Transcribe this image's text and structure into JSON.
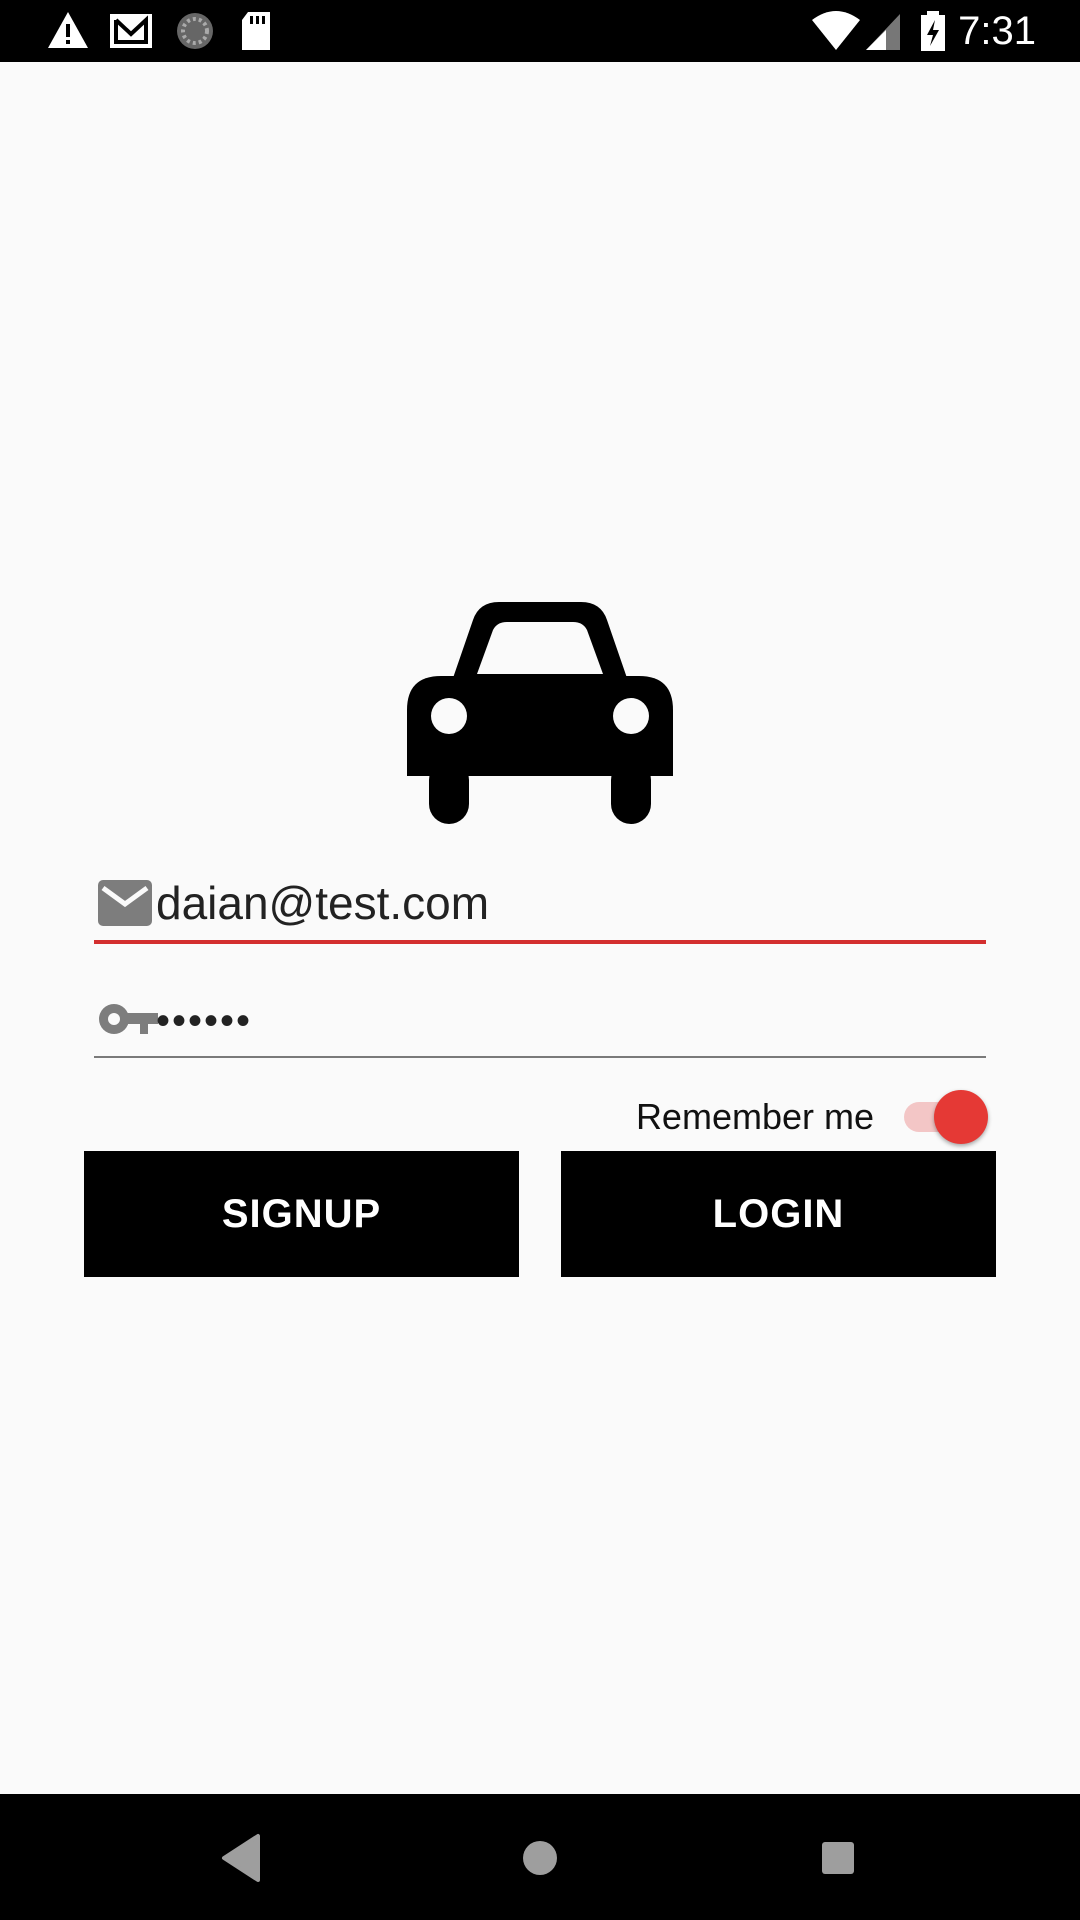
{
  "status_bar": {
    "time": "7:31",
    "left_icons": [
      "warning-icon",
      "gmail-icon",
      "sync-icon",
      "sd-card-icon"
    ],
    "right_icons": [
      "wifi-icon",
      "signal-icon",
      "battery-charging-icon"
    ]
  },
  "logo": {
    "icon": "car-icon"
  },
  "form": {
    "email": {
      "icon": "email-icon",
      "value": "daian@test.com",
      "underline_color": "#d32f2f"
    },
    "password": {
      "icon": "key-icon",
      "value": "••••••",
      "underline_color": "#7a7a7a"
    },
    "remember_me": {
      "label": "Remember me",
      "checked": true,
      "accent": "#e53935"
    }
  },
  "buttons": {
    "signup_label": "SIGNUP",
    "login_label": "LOGIN",
    "background": "#000000"
  },
  "nav_bar": {
    "buttons": [
      "back-icon",
      "home-icon",
      "recents-icon"
    ]
  }
}
